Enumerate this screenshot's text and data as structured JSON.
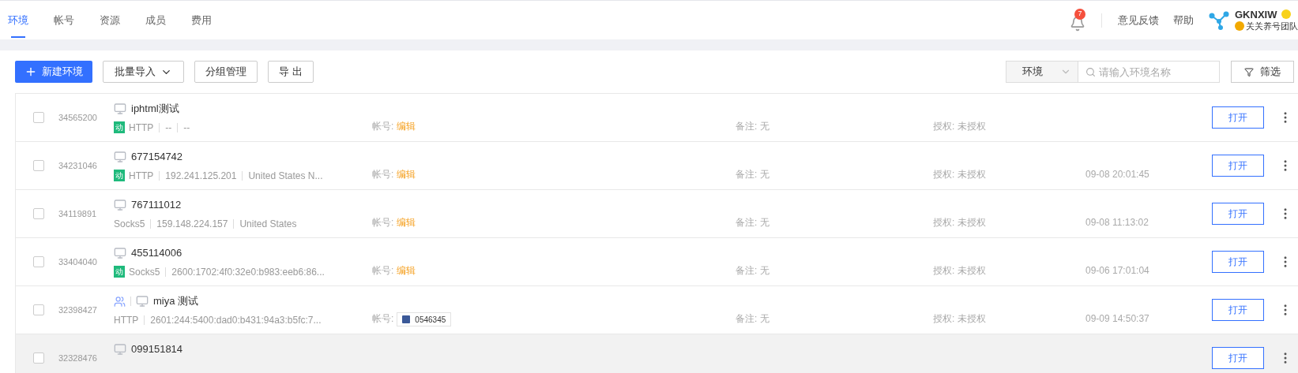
{
  "nav": {
    "tabs": [
      {
        "label": "环境",
        "selected": true
      },
      {
        "label": "帐号",
        "selected": false
      },
      {
        "label": "资源",
        "selected": false
      },
      {
        "label": "成员",
        "selected": false
      },
      {
        "label": "费用",
        "selected": false
      }
    ],
    "notification_count": "7",
    "links": [
      "意见反馈",
      "帮助"
    ],
    "user": {
      "name": "GKNXIW",
      "team": "关关养号团队"
    }
  },
  "toolbar": {
    "new_button": "新建环境",
    "import_button": "批量导入",
    "group_button": "分组管理",
    "export_button": "导 出",
    "filter_select": "环境",
    "search": {
      "placeholder": "请输入环境名称"
    },
    "filter_button": "筛选"
  },
  "rows": [
    {
      "id": "34565200",
      "team": false,
      "name": "iphtml测试",
      "dynamic_tag": "动",
      "proxy": [
        "HTTP",
        "--",
        "--"
      ],
      "account_label": "帐号:",
      "account": {
        "kind": "link",
        "text": "编辑"
      },
      "note": "备注: 无",
      "auth": "授权: 未授权",
      "time": "",
      "open": "打开",
      "highlighted": false
    },
    {
      "id": "34231046",
      "team": false,
      "name": "677154742",
      "dynamic_tag": "动",
      "proxy": [
        "HTTP",
        "192.241.125.201",
        "United States N..."
      ],
      "account_label": "帐号:",
      "account": {
        "kind": "link",
        "text": "编辑"
      },
      "note": "备注: 无",
      "auth": "授权: 未授权",
      "time": "09-08 20:01:45",
      "open": "打开",
      "highlighted": false
    },
    {
      "id": "34119891",
      "team": false,
      "name": "767111012",
      "proxy": [
        "Socks5",
        "159.148.224.157",
        "United States"
      ],
      "account_label": "帐号:",
      "account": {
        "kind": "link",
        "text": "编辑"
      },
      "note": "备注: 无",
      "auth": "授权: 未授权",
      "time": "09-08 11:13:02",
      "open": "打开",
      "highlighted": false
    },
    {
      "id": "33404040",
      "team": false,
      "name": "455114006",
      "dynamic_tag": "动",
      "proxy": [
        "Socks5",
        "2600:1702:4f0:32e0:b983:eeb6:86..."
      ],
      "account_label": "帐号:",
      "account": {
        "kind": "link",
        "text": "编辑"
      },
      "note": "备注: 无",
      "auth": "授权: 未授权",
      "time": "09-06 17:01:04",
      "open": "打开",
      "highlighted": false
    },
    {
      "id": "32398427",
      "team": true,
      "name": "miya 测试",
      "proxy": [
        "HTTP",
        "2601:244:5400:dad0:b431:94a3:b5fc:7..."
      ],
      "account_label": "帐号:",
      "account": {
        "kind": "chip",
        "text": "0546345"
      },
      "note": "备注: 无",
      "auth": "授权: 未授权",
      "time": "09-09 14:50:37",
      "open": "打开",
      "highlighted": false
    },
    {
      "id": "32328476",
      "team": false,
      "name": "099151814",
      "proxy": [],
      "open": "打开",
      "highlighted": true
    }
  ]
}
